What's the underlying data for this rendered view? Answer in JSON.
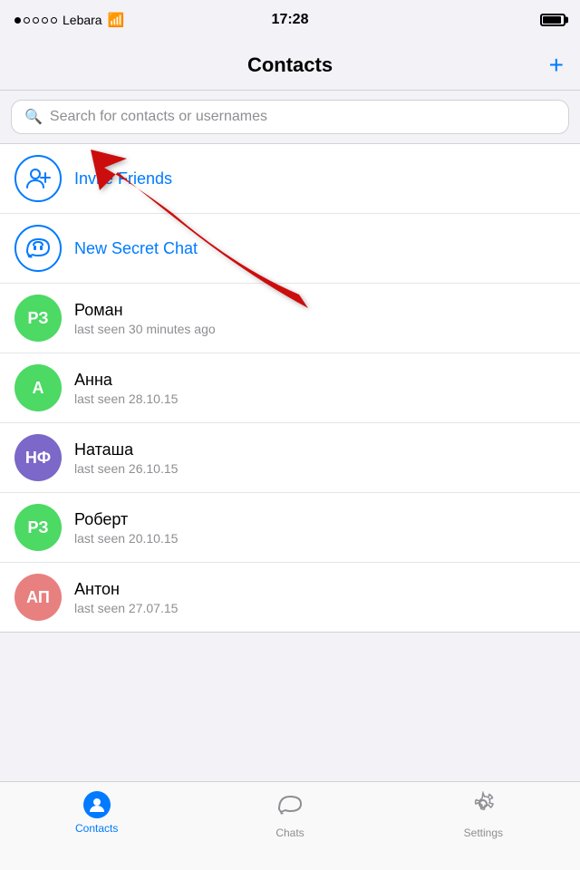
{
  "statusBar": {
    "carrier": "Lebara",
    "time": "17:28",
    "signal": [
      true,
      false,
      false,
      false,
      false
    ]
  },
  "header": {
    "title": "Contacts",
    "addButton": "+"
  },
  "search": {
    "placeholder": "Search for contacts or usernames"
  },
  "specialItems": [
    {
      "id": "invite-friends",
      "label": "Invite Friends",
      "iconType": "person-add"
    },
    {
      "id": "new-secret-chat",
      "label": "New Secret Chat",
      "iconType": "lock-chat"
    }
  ],
  "contacts": [
    {
      "initials": "РЗ",
      "name": "Роман",
      "status": "last seen 30 minutes ago",
      "color": "green"
    },
    {
      "initials": "А",
      "name": "Анна",
      "status": "last seen 28.10.15",
      "color": "green"
    },
    {
      "initials": "НФ",
      "name": "Наташа",
      "status": "last seen 26.10.15",
      "color": "purple"
    },
    {
      "initials": "РЗ",
      "name": "Роберт",
      "status": "last seen 20.10.15",
      "color": "green"
    },
    {
      "initials": "АП",
      "name": "Антон",
      "status": "last seen 27.07.15",
      "color": "salmon"
    }
  ],
  "tabBar": {
    "tabs": [
      {
        "id": "contacts",
        "label": "Contacts",
        "active": true
      },
      {
        "id": "chats",
        "label": "Chats",
        "active": false
      },
      {
        "id": "settings",
        "label": "Settings",
        "active": false
      }
    ]
  }
}
